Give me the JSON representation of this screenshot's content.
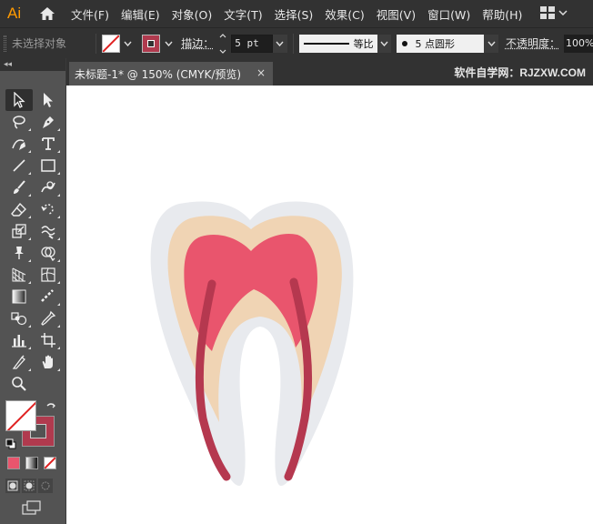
{
  "app": {
    "logo": "Ai"
  },
  "menu": [
    "文件(F)",
    "编辑(E)",
    "对象(O)",
    "文字(T)",
    "选择(S)",
    "效果(C)",
    "视图(V)",
    "窗口(W)",
    "帮助(H)"
  ],
  "control": {
    "selection": "未选择对象",
    "stroke_label": "描边：",
    "stroke_weight": "5 pt",
    "profile": "等比",
    "brush": "5 点圆形",
    "opacity_label": "不透明度：",
    "opacity": "100%"
  },
  "toolbar": {
    "collapse": "◂◂"
  },
  "document": {
    "tab_title": "未标题-1* @ 150% (CMYK/预览)",
    "close": "×",
    "watermark": "软件自学网：RJZXW.COM"
  },
  "colors": {
    "tooth_outer": "#e8eaee",
    "tooth_middle": "#f0d4b4",
    "tooth_pulp": "#e9556d",
    "tooth_root": "#b5384f",
    "stroke_swatch": "#b03a4e",
    "accent_logo": "#ff9a00"
  }
}
